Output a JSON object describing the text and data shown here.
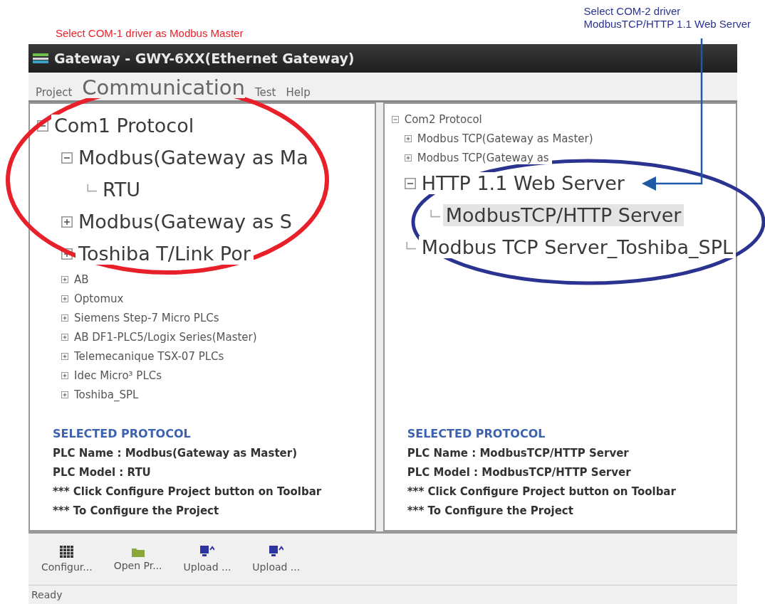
{
  "annotations": [
    {
      "kind": "left",
      "color": "#e8202a",
      "lines": [
        "Select COM-1 driver as Modbus Master"
      ]
    },
    {
      "kind": "right",
      "color": "#2b3390",
      "lines": [
        "Select COM-2 driver",
        "ModbusTCP/HTTP 1.1 Web Server"
      ]
    }
  ],
  "window": {
    "title": "Gateway - GWY-6XX(Ethernet Gateway)"
  },
  "menu": [
    {
      "label": "Project",
      "kind": "normal"
    },
    {
      "label": "Communication",
      "kind": "magnified"
    },
    {
      "label": "Test",
      "kind": "normal"
    },
    {
      "label": "Help",
      "kind": "normal"
    }
  ],
  "panels": [
    {
      "tree": [
        {
          "label": "Com1 Protocol",
          "kind": "magnified",
          "expanded": true,
          "selected": false,
          "children": [
            {
              "label": "Modbus(Gateway as Ma",
              "kind": "magnified",
              "expanded": true,
              "selected": false,
              "children": [
                {
                  "label": "RTU",
                  "kind": "magnified",
                  "selected": false
                }
              ]
            },
            {
              "label": "Modbus(Gateway as S",
              "kind": "magnified",
              "expanded": false,
              "selected": false
            },
            {
              "label": "Toshiba T/Link Por",
              "kind": "magnified",
              "expanded": false,
              "selected": false
            },
            {
              "label": "AB",
              "kind": "normal",
              "expanded": false,
              "selected": false
            },
            {
              "label": "Optomux",
              "kind": "normal",
              "expanded": false,
              "selected": false
            },
            {
              "label": "Siemens Step-7 Micro PLCs",
              "kind": "normal",
              "expanded": false,
              "selected": false
            },
            {
              "label": "AB DF1-PLC5/Logix Series(Master)",
              "kind": "normal",
              "expanded": false,
              "selected": false
            },
            {
              "label": "Telemecanique TSX-07 PLCs",
              "kind": "normal",
              "expanded": false,
              "selected": false
            },
            {
              "label": "Idec Micro³ PLCs",
              "kind": "normal",
              "expanded": false,
              "selected": false
            },
            {
              "label": "Toshiba_SPL",
              "kind": "normal",
              "expanded": false,
              "selected": false
            }
          ]
        }
      ],
      "info": {
        "heading": "SELECTED PROTOCOL",
        "lines": [
          "PLC Name : Modbus(Gateway as Master)",
          "PLC Model : RTU",
          "*** Click Configure Project button on Toolbar",
          "*** To Configure the Project"
        ]
      }
    },
    {
      "tree": [
        {
          "label": "Com2 Protocol",
          "kind": "normal",
          "expanded": true,
          "selected": false,
          "children": [
            {
              "label": "Modbus TCP(Gateway as Master)",
              "kind": "normal",
              "expanded": false,
              "selected": false
            },
            {
              "label": "Modbus TCP(Gateway as",
              "kind": "normal",
              "expanded": false,
              "selected": false
            },
            {
              "label": "HTTP 1.1 Web Server",
              "kind": "magnified",
              "expanded": true,
              "selected": false,
              "children": [
                {
                  "label": "ModbusTCP/HTTP Server",
                  "kind": "magnified",
                  "selected": true
                }
              ]
            },
            {
              "label": "Modbus TCP Server_Toshiba_SPL",
              "kind": "magnified",
              "selected": false
            }
          ]
        }
      ],
      "info": {
        "heading": "SELECTED PROTOCOL",
        "lines": [
          "PLC Name : ModbusTCP/HTTP Server",
          "PLC Model : ModbusTCP/HTTP Server",
          "*** Click Configure Project button on Toolbar",
          "*** To Configure the Project"
        ]
      }
    }
  ],
  "toolbar": [
    {
      "label": "Configur...",
      "kind": "configure"
    },
    {
      "label": "Open Pr...",
      "kind": "open"
    },
    {
      "label": "Upload ...",
      "kind": "upload"
    },
    {
      "label": "Upload ...",
      "kind": "upload"
    }
  ],
  "status_bar": {
    "text": "Ready"
  }
}
